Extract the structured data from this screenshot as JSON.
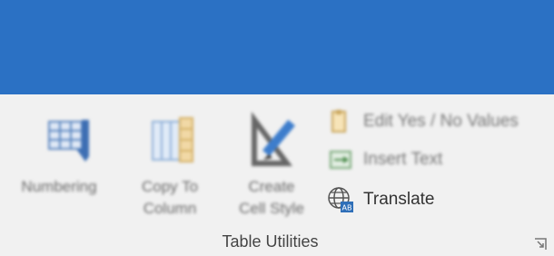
{
  "ribbon": {
    "group_label": "Table Utilities",
    "buttons": [
      {
        "label": "Numbering",
        "icon": "numbering-icon"
      },
      {
        "label": "Copy To\nColumn",
        "icon": "copy-to-column-icon"
      },
      {
        "label": "Create\nCell Style",
        "icon": "create-cell-style-icon"
      }
    ],
    "small_buttons": [
      {
        "label": "Edit Yes / No Values",
        "icon": "edit-yes-no-icon"
      },
      {
        "label": "Insert Text",
        "icon": "insert-text-icon"
      },
      {
        "label": "Translate",
        "icon": "translate-globe-icon"
      }
    ]
  },
  "colors": {
    "titlebar": "#2b71c4",
    "ribbon_bg": "#f1f1f1"
  }
}
